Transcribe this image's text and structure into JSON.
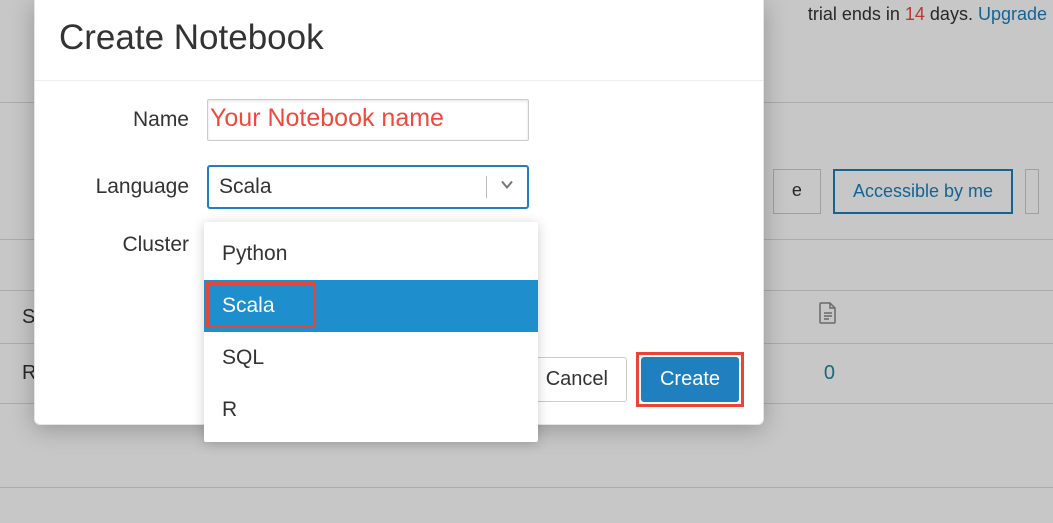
{
  "banner": {
    "trial_prefix": "trial ends in ",
    "trial_days": "14",
    "trial_suffix": " days. ",
    "upgrade": "Upgrade"
  },
  "bg": {
    "button_owned_suffix": "e",
    "button_accessible": "Accessible by me",
    "col_s": "S",
    "col_r": "R",
    "zero": "0"
  },
  "modal": {
    "title": "Create Notebook",
    "labels": {
      "name": "Name",
      "language": "Language",
      "cluster": "Cluster"
    },
    "name_value": "",
    "name_annotation": "Your Notebook name",
    "language_selected": "Scala",
    "language_options": [
      "Python",
      "Scala",
      "SQL",
      "R"
    ],
    "cancel": "Cancel",
    "create": "Create"
  }
}
